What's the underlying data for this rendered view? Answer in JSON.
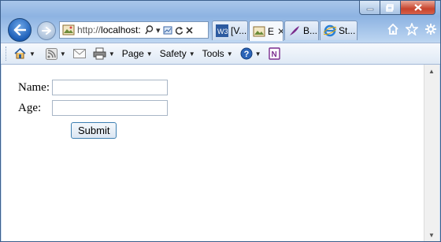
{
  "browser": {
    "address": {
      "scheme": "http://",
      "host": "localhost:"
    },
    "tabs": [
      {
        "label": "[V..."
      },
      {
        "label": "E"
      },
      {
        "label": "B..."
      },
      {
        "label": "St..."
      }
    ],
    "icons": {
      "back": "back-arrow-icon",
      "forward": "forward-arrow-icon",
      "home": "home-icon",
      "favorites": "star-icon",
      "tools": "gear-icon"
    }
  },
  "commandbar": {
    "page": "Page",
    "safety": "Safety",
    "tools": "Tools"
  },
  "form": {
    "name_label": "Name:",
    "age_label": "Age:",
    "name_value": "",
    "age_value": "",
    "submit_label": "Submit"
  },
  "colors": {
    "frame": "#8db3e2",
    "back_button": "#1d5fb8",
    "close_button": "#c7432c",
    "submit_border": "#3c7fb1"
  }
}
